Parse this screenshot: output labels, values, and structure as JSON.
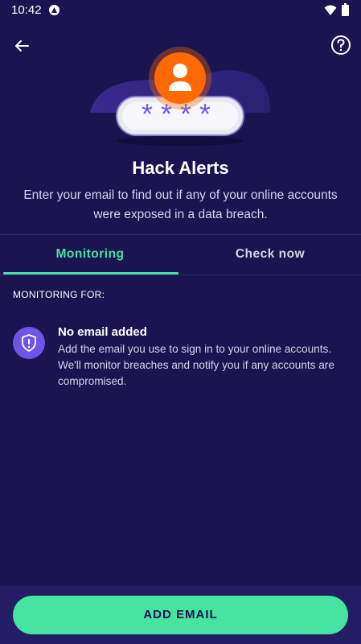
{
  "status_bar": {
    "time": "10:42",
    "icons": [
      "app-notification-icon",
      "wifi-icon",
      "battery-icon"
    ]
  },
  "header": {
    "back_icon": "arrow-left-icon",
    "help_icon": "help-circle-icon"
  },
  "hero": {
    "password_mask": "****",
    "icon": "user-avatar-icon"
  },
  "page": {
    "title": "Hack Alerts",
    "subtitle": "Enter your email to find out if any of your online accounts were exposed in a data breach."
  },
  "tabs": [
    {
      "label": "Monitoring",
      "active": true
    },
    {
      "label": "Check now",
      "active": false
    }
  ],
  "monitoring": {
    "section_label": "MONITORING FOR:",
    "empty_state": {
      "icon": "shield-alert-icon",
      "title": "No email added",
      "description": "Add the email you use to sign in to your online accounts. We'll monitor breaches and notify you if any accounts are compromised."
    }
  },
  "footer": {
    "add_email_label": "ADD EMAIL"
  },
  "colors": {
    "background": "#1a1450",
    "accent": "#47e3a0",
    "purple": "#7054e8",
    "orange": "#ff6a00"
  }
}
